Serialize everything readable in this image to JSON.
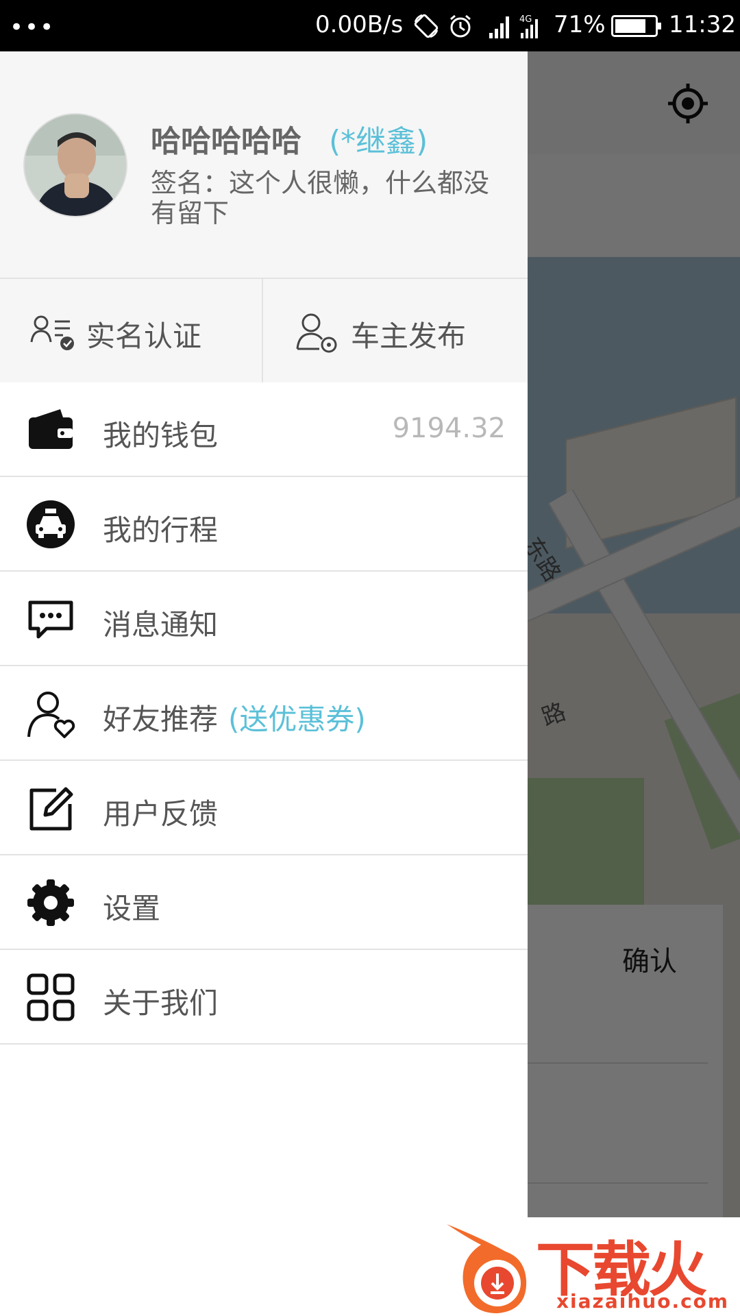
{
  "status_bar": {
    "dots": "•••",
    "net_speed": "0.00B/s",
    "network_type": "4G",
    "battery_percent": "71%",
    "battery_level": 0.71,
    "time": "11:32"
  },
  "profile": {
    "username": "哈哈哈哈哈",
    "nickname": "(*继鑫)",
    "signature": "签名：这个人很懒，什么都没有留下"
  },
  "quick_actions": [
    {
      "label": "实名认证",
      "icon": "user-verified-icon"
    },
    {
      "label": "车主发布",
      "icon": "driver-publish-icon"
    }
  ],
  "menu": [
    {
      "label": "我的钱包",
      "icon": "wallet-icon",
      "value": "9194.32"
    },
    {
      "label": "我的行程",
      "icon": "taxi-icon"
    },
    {
      "label": "消息通知",
      "icon": "message-icon"
    },
    {
      "label": "好友推荐",
      "icon": "friend-heart-icon",
      "extra": "(送优惠券)"
    },
    {
      "label": "用户反馈",
      "icon": "edit-icon"
    },
    {
      "label": "设置",
      "icon": "gear-icon"
    },
    {
      "label": "关于我们",
      "icon": "grid-icon"
    }
  ],
  "background": {
    "confirm_label": "确认",
    "road_label_1": "东路",
    "road_label_2": "路"
  },
  "watermark": {
    "brand": "下载火",
    "url": "xiazaihuo.com"
  },
  "colors": {
    "accent": "#5bc0d8",
    "text": "#555555",
    "divider": "#e3e3e3",
    "watermark": "#e8482f"
  }
}
